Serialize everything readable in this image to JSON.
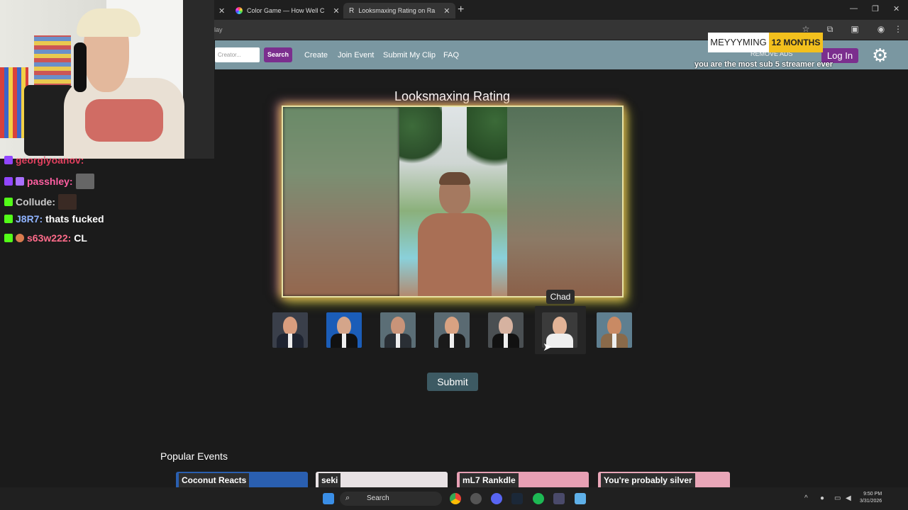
{
  "browser": {
    "tabs": [
      {
        "title": "Color Game — How Well C",
        "active": false
      },
      {
        "title": "Looksmaxing Rating on Ra",
        "active": true
      }
    ],
    "new_tab": "+",
    "address_partial": "lay"
  },
  "site_nav": {
    "search_placeholder": "Creator...",
    "search_button": "Search",
    "links": [
      "Create",
      "Join Event",
      "Submit My Clip",
      "FAQ"
    ],
    "remove_ads": "REMOVE ADS",
    "login": "Log In"
  },
  "overlay": {
    "username": "MEYYYMING",
    "months": "12 MONTHS",
    "message": "you are the most sub 5 streamer ever"
  },
  "chat": [
    {
      "user": "georgiyoanov:",
      "color": "#e0405e",
      "message": ""
    },
    {
      "user": "passhley:",
      "color": "#ff5fa2",
      "message": ""
    },
    {
      "user": "Collude:",
      "color": "#c9c9c9",
      "message": ""
    },
    {
      "user": "J8R7:",
      "color": "#8fb3ff",
      "message": "thats fucked"
    },
    {
      "user": "s63w222:",
      "color": "#ff6b8a",
      "message": "CL"
    }
  ],
  "main": {
    "title": "Looksmaxing Rating",
    "hover_tooltip": "Chad",
    "submit": "Submit",
    "rating_faces": [
      {
        "bg": "#3a3f4a",
        "skin": "#d99d7e",
        "suit": "#1e2330"
      },
      {
        "bg": "#1b5db8",
        "skin": "#d4a58a",
        "suit": "#111"
      },
      {
        "bg": "#5b6e76",
        "skin": "#c99479",
        "suit": "#2a2f35"
      },
      {
        "bg": "#5a6a72",
        "skin": "#d8a282",
        "suit": "#1a1a1a"
      },
      {
        "bg": "#4a4f52",
        "skin": "#d6b2a0",
        "suit": "#111"
      },
      {
        "bg": "#3b3b3b",
        "skin": "#e2b396",
        "suit": "#eee"
      },
      {
        "bg": "#5f7f90",
        "skin": "#c98a64",
        "suit": "#8a6a4a"
      }
    ]
  },
  "popular": {
    "heading": "Popular Events",
    "cards": [
      {
        "label": "Coconut Reacts",
        "bg": "#2a5fb0"
      },
      {
        "label": "seki",
        "bg": "#e8e2e4"
      },
      {
        "label": "mL7 Rankdle",
        "bg": "#e7a0b4"
      },
      {
        "label": "You're probably silver",
        "bg": "#e9a6b8"
      }
    ]
  },
  "taskbar": {
    "search": "Search",
    "time": "9:50 PM",
    "date": "3/31/2026"
  }
}
